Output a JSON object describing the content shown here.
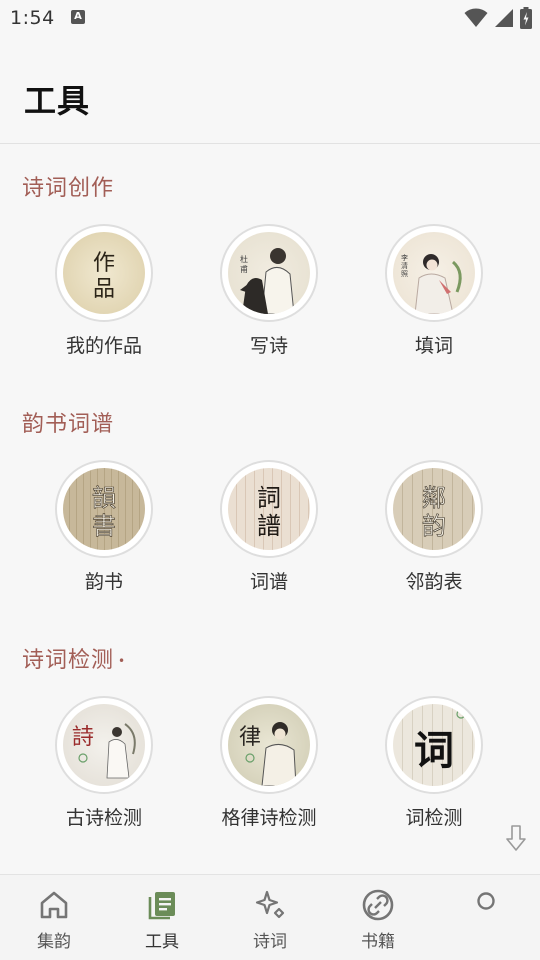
{
  "status": {
    "time": "1:54",
    "notif_badge": "A"
  },
  "header": {
    "title": "工具"
  },
  "sections": [
    {
      "title": "诗词创作",
      "tools": [
        {
          "label": "我的作品",
          "icon": "works-icon",
          "art": "作品"
        },
        {
          "label": "写诗",
          "icon": "poet-portrait-icon",
          "art": "杜甫"
        },
        {
          "label": "填词",
          "icon": "lady-portrait-icon",
          "art": "李清照"
        }
      ]
    },
    {
      "title": "韵书词谱",
      "tools": [
        {
          "label": "韵书",
          "icon": "rhyme-book-icon",
          "art": "韻書"
        },
        {
          "label": "词谱",
          "icon": "ci-pattern-icon",
          "art": "詞譜"
        },
        {
          "label": "邻韵表",
          "icon": "neighbor-rhyme-icon",
          "art": "鄰韵"
        }
      ]
    },
    {
      "title": "诗词检测",
      "title_suffix": "•",
      "tools": [
        {
          "label": "古诗检测",
          "icon": "ancient-poem-check-icon",
          "art": "詩"
        },
        {
          "label": "格律诗检测",
          "icon": "regulated-verse-check-icon",
          "art": "律"
        },
        {
          "label": "词检测",
          "icon": "ci-check-icon",
          "art": "词"
        }
      ]
    }
  ],
  "tabbar": {
    "tabs": [
      {
        "label": "集韵",
        "icon": "home-icon",
        "active": false
      },
      {
        "label": "工具",
        "icon": "tools-book-icon",
        "active": true
      },
      {
        "label": "诗词",
        "icon": "sparkle-icon",
        "active": false
      },
      {
        "label": "书籍",
        "icon": "link-icon",
        "active": false
      },
      {
        "label": "",
        "icon": "circle-icon",
        "active": false
      }
    ]
  },
  "colors": {
    "accent": "#a25e56",
    "tab_active": "#6b8c58",
    "tab_inactive": "#757575"
  }
}
